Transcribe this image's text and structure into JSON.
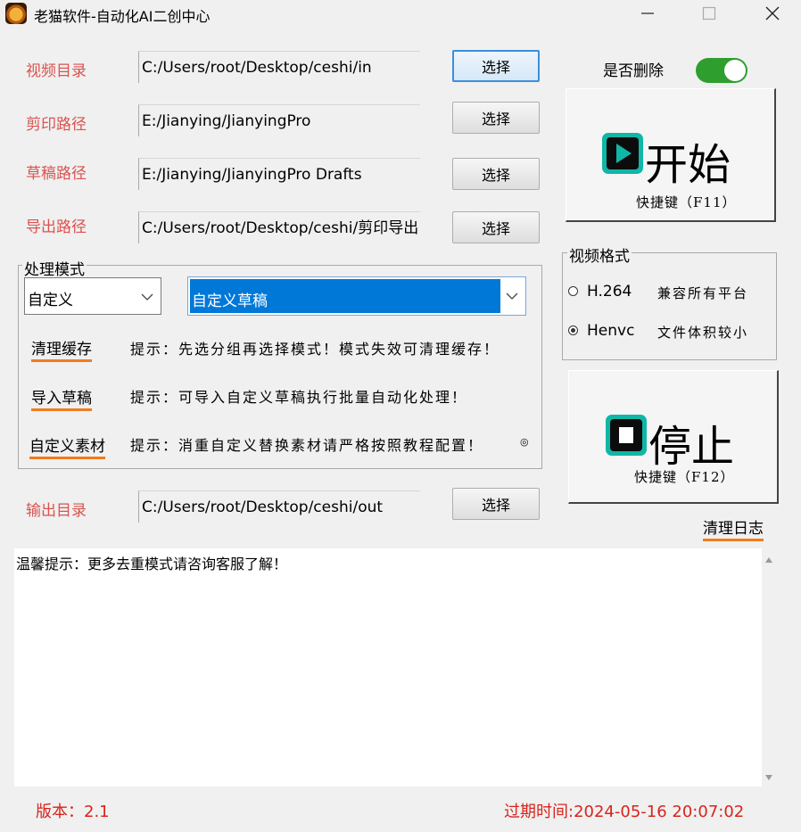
{
  "window": {
    "title": "老猫软件-自动化AI二创中心"
  },
  "paths": [
    {
      "label": "视频目录",
      "value": "C:/Users/root/Desktop/ceshi/in",
      "button": "选择"
    },
    {
      "label": "剪印路径",
      "value": "E:/Jianying/JianyingPro",
      "button": "选择"
    },
    {
      "label": "草稿路径",
      "value": "E:/Jianying/JianyingPro Drafts",
      "button": "选择"
    },
    {
      "label": "导出路径",
      "value": "C:/Users/root/Desktop/ceshi/剪印导出",
      "button": "选择"
    }
  ],
  "mode": {
    "legend": "处理模式",
    "combo1_value": "自定义",
    "combo2_value": "自定义草稿",
    "actions": [
      {
        "label": "清理缓存",
        "hint": "提示：先选分组再选择模式！模式失效可清理缓存！"
      },
      {
        "label": "导入草稿",
        "hint": "提示：可导入自定义草稿执行批量自动化处理！"
      },
      {
        "label": "自定义素材",
        "hint": "提示：消重自定义替换素材请严格按照教程配置！"
      }
    ],
    "trailing_mark": "◎"
  },
  "output": {
    "label": "输出目录",
    "value": "C:/Users/root/Desktop/ceshi/out",
    "button": "选择"
  },
  "delete_toggle": {
    "label": "是否删除",
    "on": true
  },
  "start": {
    "label": "开始",
    "shortcut": "快捷键（F11）"
  },
  "format": {
    "legend": "视频格式",
    "options": [
      {
        "name": "H.264",
        "desc": "兼容所有平台",
        "selected": false
      },
      {
        "name": "Henvc",
        "desc": "文件体积较小",
        "selected": true
      }
    ]
  },
  "stop": {
    "label": "停止",
    "shortcut": "快捷键（F12）"
  },
  "clear_log": "清理日志",
  "log_text": "温馨提示：更多去重模式请咨询客服了解！",
  "footer": {
    "version": "版本：2.1",
    "expiry": "过期时间:2024-05-16 20:07:02"
  },
  "colors": {
    "accent_red": "#d9534f",
    "toggle_green": "#2e9e2e",
    "icon_teal": "#10b6a6",
    "underline_orange": "#f07c1e",
    "select_blue": "#0078d7"
  }
}
